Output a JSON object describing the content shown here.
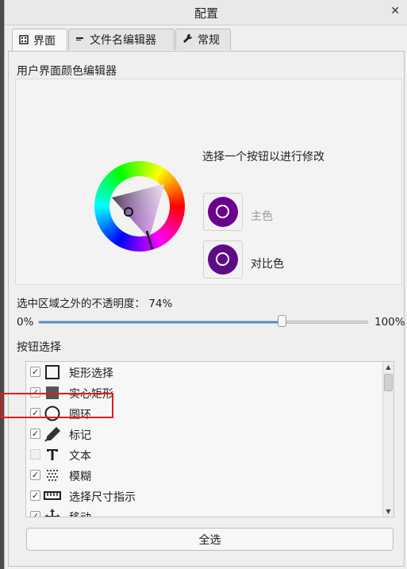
{
  "window": {
    "title": "配置",
    "close_glyph": "✕"
  },
  "tabs": [
    {
      "label": "界面",
      "icon": "grid-icon",
      "active": true
    },
    {
      "label": "文件名编辑器",
      "icon": "minus-icon",
      "active": false
    },
    {
      "label": "常规",
      "icon": "wrench-icon",
      "active": false
    }
  ],
  "color_editor": {
    "section_label": "用户界面颜色编辑器",
    "hint": "选择一个按钮以进行修改",
    "primary": {
      "label": "主色",
      "color": "#6a008e"
    },
    "contrast": {
      "label": "对比色",
      "color": "#5e0c86"
    }
  },
  "opacity": {
    "label": "选中区域之外的不透明度：",
    "value_text": "74%",
    "min_label": "0%",
    "max_label": "100%",
    "value": 74
  },
  "buttons_section": {
    "label": "按钮选择",
    "items": [
      {
        "label": "矩形选择",
        "checked": true,
        "icon": "rectangle-outline-icon"
      },
      {
        "label": "实心矩形",
        "checked": true,
        "icon": "rectangle-filled-icon"
      },
      {
        "label": "圆环",
        "checked": true,
        "icon": "circle-icon"
      },
      {
        "label": "标记",
        "checked": true,
        "icon": "marker-icon"
      },
      {
        "label": "文本",
        "checked": false,
        "icon": "text-icon"
      },
      {
        "label": "模糊",
        "checked": true,
        "icon": "blur-icon"
      },
      {
        "label": "选择尺寸指示",
        "checked": true,
        "icon": "ruler-icon"
      },
      {
        "label": "移动",
        "checked": true,
        "icon": "move-icon"
      }
    ],
    "select_all_label": "全选"
  },
  "colors": {
    "accent": "#3a8fdb",
    "highlight": "#e21b1b"
  }
}
